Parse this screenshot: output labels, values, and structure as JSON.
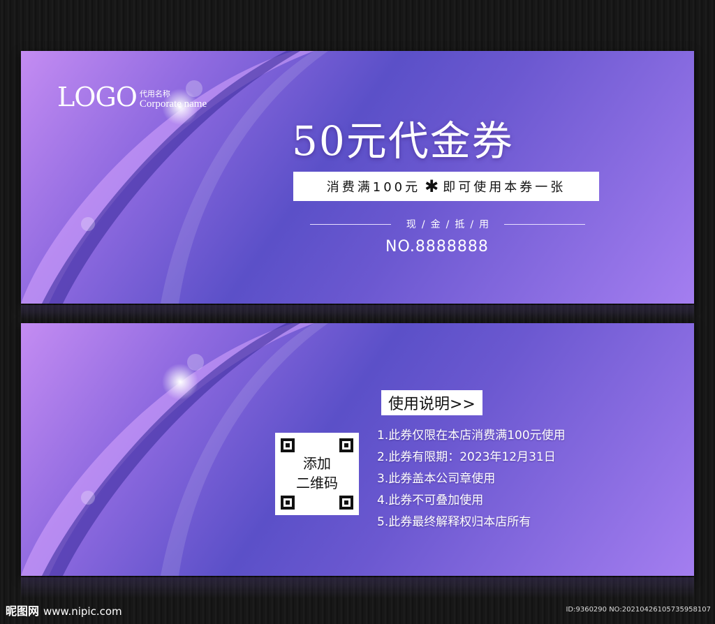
{
  "front": {
    "logo": {
      "main": "LOGO",
      "name_cn": "代用名称",
      "name_en": "Corporate name"
    },
    "title": "50元代金券",
    "condition": {
      "left": "消费满100元",
      "flower": "✱",
      "right": "即可使用本券一张"
    },
    "cash_label": "现/金/抵/用",
    "serial": "NO.8888888"
  },
  "back": {
    "instructions_title": "使用说明>>",
    "qr_text": [
      "添加",
      "二维码"
    ],
    "rules": [
      "1.此券仅限在本店消费满100元使用",
      "2.此券有限期：2023年12月31日",
      "3.此券盖本公司章使用",
      "4.此券不可叠加使用",
      "5.此券最终解释权归本店所有"
    ]
  },
  "watermark": {
    "site_cn": "昵图网",
    "site_url": "www.nipic.com",
    "id_text": "ID:9360290 NO:20210426105735958107"
  },
  "colors": {
    "card_dark": "#5b50c8",
    "card_light": "#c48cf2"
  }
}
